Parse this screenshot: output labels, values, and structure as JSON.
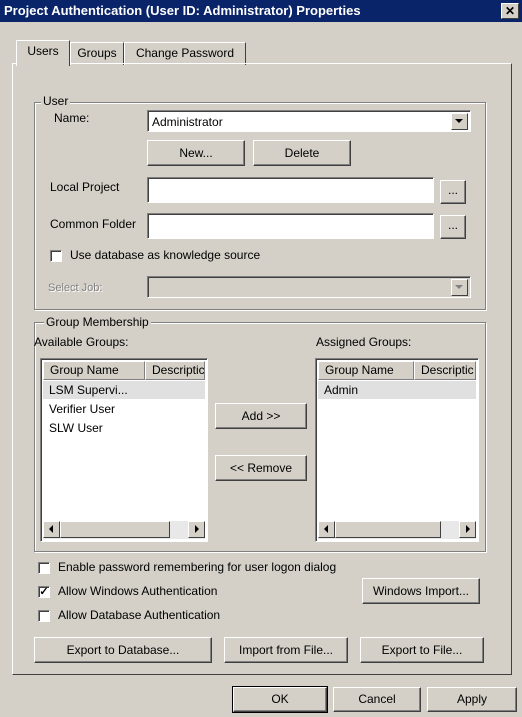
{
  "window": {
    "title": "Project Authentication (User ID: Administrator) Properties",
    "close": "✕"
  },
  "tabs": [
    {
      "label": "Users"
    },
    {
      "label": "Groups"
    },
    {
      "label": "Change Password"
    }
  ],
  "user_group": {
    "legend": "User",
    "name_label": "Name:",
    "name_value": "Administrator",
    "new_button": "New...",
    "delete_button": "Delete",
    "local_project_label": "Local Project",
    "local_project_value": "",
    "browse": "...",
    "common_folder_label": "Common Folder",
    "common_folder_value": "",
    "use_db_checkbox": {
      "label": "Use database as knowledge source",
      "checked": false
    },
    "select_job_label": "Select Job:",
    "select_job_value": ""
  },
  "membership": {
    "legend": "Group Membership",
    "available_label": "Available Groups:",
    "assigned_label": "Assigned Groups:",
    "columns": [
      "Group Name",
      "Descriptic"
    ],
    "available": [
      "LSM Supervi...",
      "Verifier User",
      "SLW User"
    ],
    "assigned": [
      "Admin"
    ],
    "add_button": "Add >>",
    "remove_button": "<< Remove"
  },
  "options": {
    "remember_password": {
      "label": "Enable password remembering for user logon dialog",
      "checked": false
    },
    "windows_auth": {
      "label": "Allow Windows Authentication",
      "checked": true
    },
    "db_auth": {
      "label": "Allow Database Authentication",
      "checked": false
    },
    "windows_import_button": "Windows Import..."
  },
  "actions": {
    "export_db": "Export to Database...",
    "import_file": "Import from File...",
    "export_file": "Export to File..."
  },
  "footer": {
    "ok": "OK",
    "cancel": "Cancel",
    "apply": "Apply"
  },
  "colors": {
    "titlebar": "#0a246a",
    "face": "#d4d0c8"
  }
}
